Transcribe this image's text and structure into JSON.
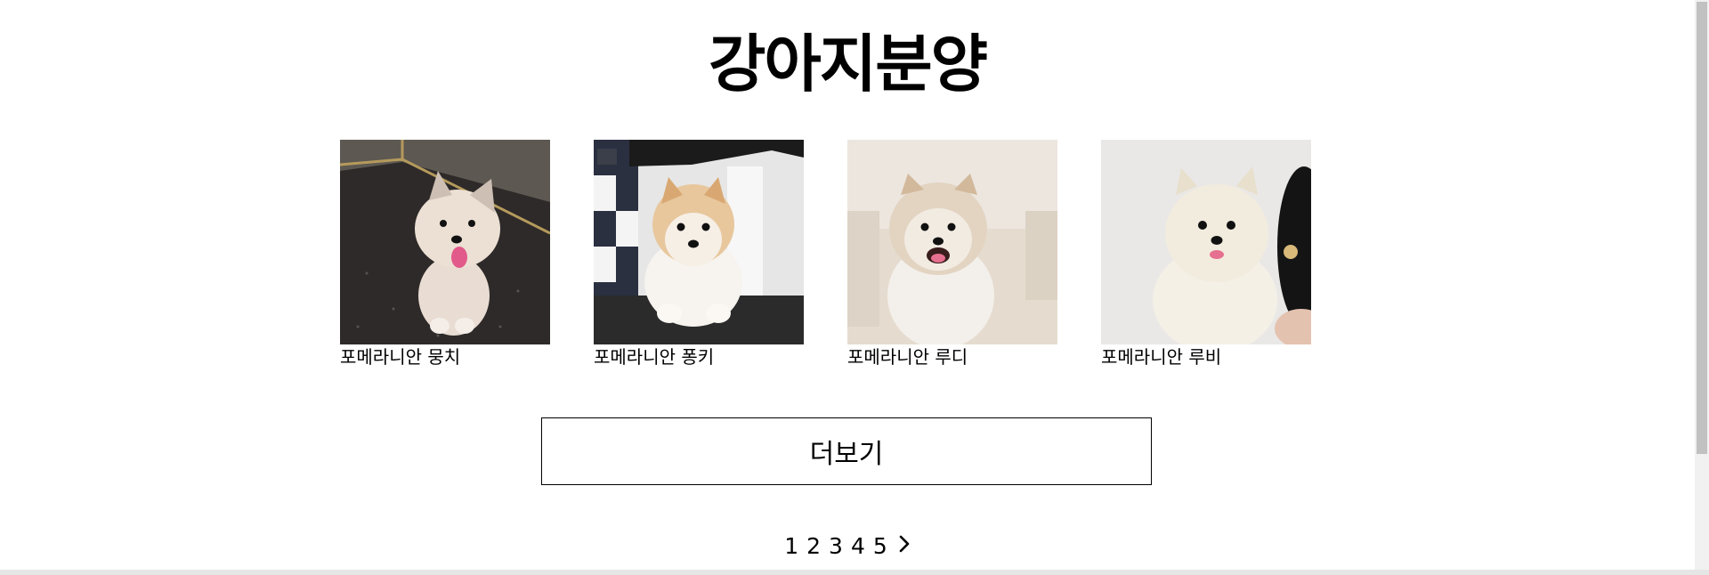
{
  "page": {
    "title": "강아지분양"
  },
  "puppies": [
    {
      "name": "포메라니안 뭉치"
    },
    {
      "name": "포메라니안 퐁키"
    },
    {
      "name": "포메라니안 루디"
    },
    {
      "name": "포메라니안 루비"
    }
  ],
  "more_button": {
    "label": "더보기"
  },
  "pagination": {
    "pages": [
      "1",
      "2",
      "3",
      "4",
      "5"
    ],
    "next_icon": "chevron-right-icon"
  }
}
